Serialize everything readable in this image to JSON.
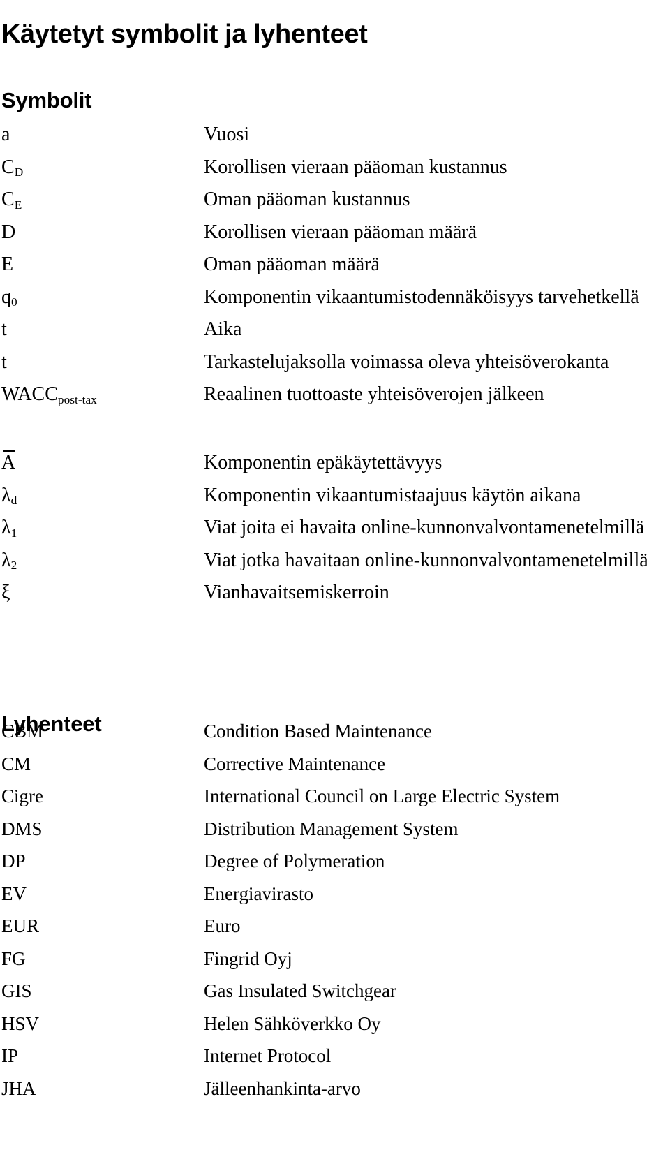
{
  "document": {
    "title": "Käytetyt symbolit ja lyhenteet"
  },
  "symbols_section": {
    "heading": "Symbolit",
    "groups": [
      {
        "rows": [
          {
            "symbol": "a",
            "sub": "",
            "overbar": false,
            "description": "Vuosi"
          },
          {
            "symbol": "C",
            "sub": "D",
            "overbar": false,
            "description": "Korollisen vieraan pääoman kustannus"
          },
          {
            "symbol": "C",
            "sub": "E",
            "overbar": false,
            "description": "Oman pääoman kustannus"
          },
          {
            "symbol": "D",
            "sub": "",
            "overbar": false,
            "description": "Korollisen vieraan pääoman määrä"
          },
          {
            "symbol": "E",
            "sub": "",
            "overbar": false,
            "description": "Oman pääoman määrä"
          },
          {
            "symbol": "q",
            "sub": "0",
            "overbar": false,
            "description": "Komponentin vikaantumistodennäköisyys tarvehetkellä"
          },
          {
            "symbol": "t",
            "sub": "",
            "overbar": false,
            "description": "Aika"
          },
          {
            "symbol": "t",
            "sub": "",
            "overbar": false,
            "description": "Tarkastelujaksolla voimassa oleva yhteisöverokanta"
          },
          {
            "symbol": "WACC",
            "sub": "post-tax",
            "overbar": false,
            "description": "Reaalinen tuottoaste yhteisöverojen jälkeen"
          }
        ]
      },
      {
        "rows": [
          {
            "symbol": "A",
            "sub": "",
            "overbar": true,
            "description": "Komponentin epäkäytettävyys"
          },
          {
            "symbol": "λ",
            "sub": "d",
            "overbar": false,
            "description": "Komponentin vikaantumistaajuus käytön aikana"
          },
          {
            "symbol": "λ",
            "sub": "1",
            "overbar": false,
            "description": "Viat joita ei havaita online-kunnonvalvontamenetelmillä"
          },
          {
            "symbol": "λ",
            "sub": "2",
            "overbar": false,
            "description": "Viat jotka havaitaan online-kunnonvalvontamenetelmillä"
          },
          {
            "symbol": "ξ",
            "sub": "",
            "overbar": false,
            "description": "Vianhavaitsemiskerroin"
          }
        ]
      }
    ]
  },
  "abbreviations_section": {
    "heading": "Lyhenteet",
    "rows": [
      {
        "abbr": "CBM",
        "definition": "Condition Based Maintenance"
      },
      {
        "abbr": "CM",
        "definition": "Corrective Maintenance"
      },
      {
        "abbr": "Cigre",
        "definition": "International Council on Large Electric System"
      },
      {
        "abbr": "DMS",
        "definition": "Distribution Management System"
      },
      {
        "abbr": "DP",
        "definition": "Degree of Polymeration"
      },
      {
        "abbr": "EV",
        "definition": "Energiavirasto"
      },
      {
        "abbr": "EUR",
        "definition": "Euro"
      },
      {
        "abbr": "FG",
        "definition": "Fingrid Oyj"
      },
      {
        "abbr": "GIS",
        "definition": "Gas Insulated Switchgear"
      },
      {
        "abbr": "HSV",
        "definition": "Helen Sähköverkko Oy"
      },
      {
        "abbr": "IP",
        "definition": "Internet Protocol"
      },
      {
        "abbr": "JHA",
        "definition": "Jälleenhankinta-arvo"
      }
    ]
  }
}
